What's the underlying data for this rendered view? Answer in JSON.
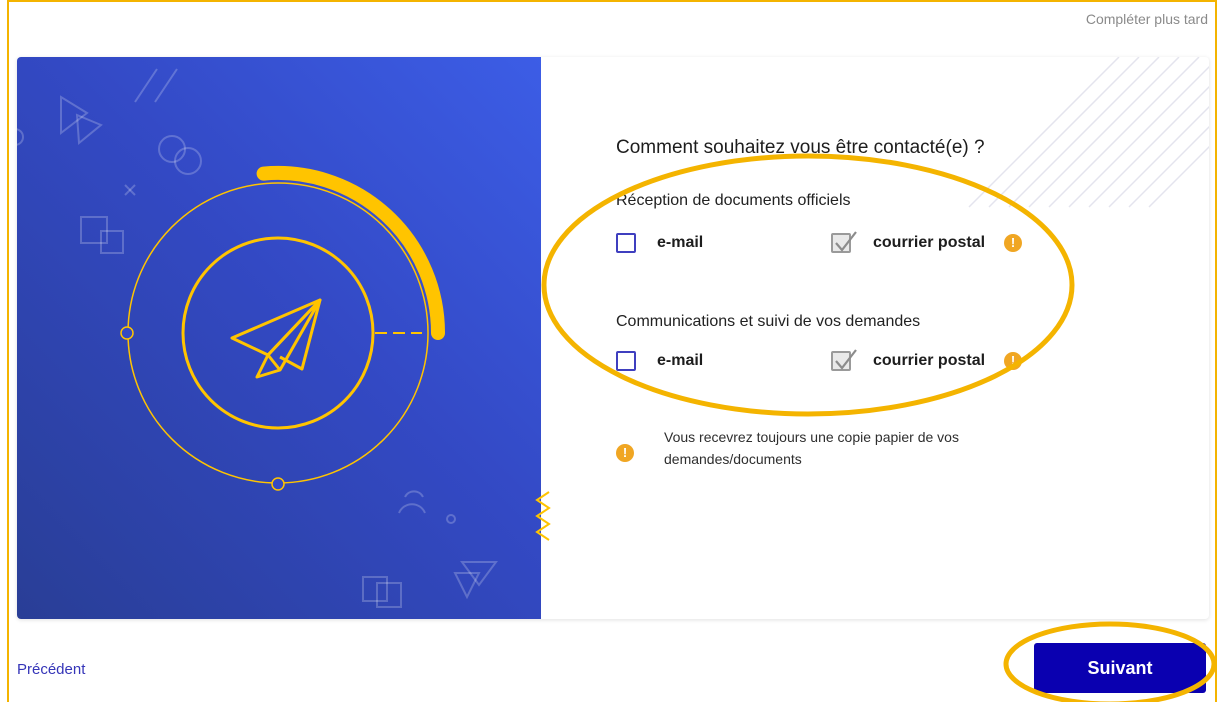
{
  "header": {
    "complete_later": "Compléter plus tard"
  },
  "form": {
    "question": "Comment souhaitez vous être contacté(e) ?",
    "sections": [
      {
        "label": "Réception de documents officiels",
        "options": [
          {
            "label": "e-mail",
            "checked": false
          },
          {
            "label": "courrier postal",
            "checked": true,
            "warning": "!"
          }
        ]
      },
      {
        "label": "Communications et suivi de vos demandes",
        "options": [
          {
            "label": "e-mail",
            "checked": false
          },
          {
            "label": "courrier postal",
            "checked": true,
            "warning": "!"
          }
        ]
      }
    ],
    "info": {
      "icon": "!",
      "text": "Vous recevrez toujours une copie papier de vos demandes/documents"
    }
  },
  "footer": {
    "previous_label": "Précédent",
    "next_label": "Suivant"
  },
  "colors": {
    "primary": "#0a00b0",
    "illustration_bg": "#3349c4",
    "accent_yellow": "#ffc400",
    "warning_orange": "#f0a623",
    "annotation": "#f4b400"
  },
  "progress": {
    "fraction": 0.25
  }
}
